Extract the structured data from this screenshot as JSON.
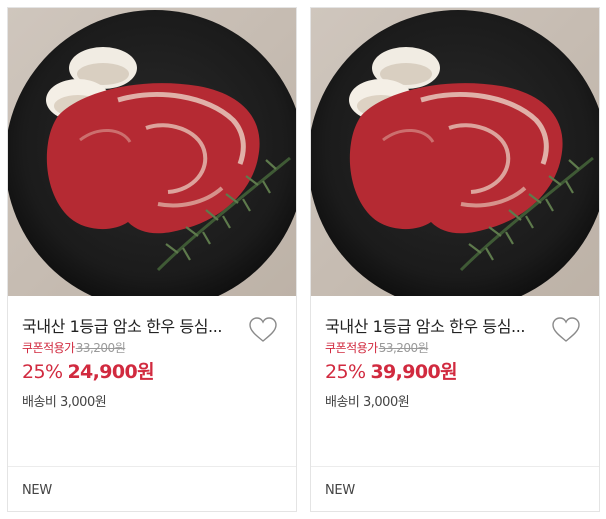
{
  "products": [
    {
      "image_alt": "steak",
      "title": "국내산 1등급 암소 한우 등심...",
      "coupon_label": "쿠폰적용가",
      "original_price": "33,200원",
      "discount": "25%",
      "sale_price": "24,900",
      "currency": "원",
      "shipping": "배송비 3,000원",
      "badge": "NEW",
      "wishlist_icon": "heart-outline-icon"
    },
    {
      "image_alt": "steak",
      "title": "국내산 1등급 암소 한우 등심...",
      "coupon_label": "쿠폰적용가",
      "original_price": "53,200원",
      "discount": "25%",
      "sale_price": "39,900",
      "currency": "원",
      "shipping": "배송비 3,000원",
      "badge": "NEW",
      "wishlist_icon": "heart-outline-icon"
    }
  ],
  "colors": {
    "accent": "#d12a3f",
    "muted": "#9a9a9a",
    "border": "#e4e4e4",
    "text": "#222222"
  }
}
